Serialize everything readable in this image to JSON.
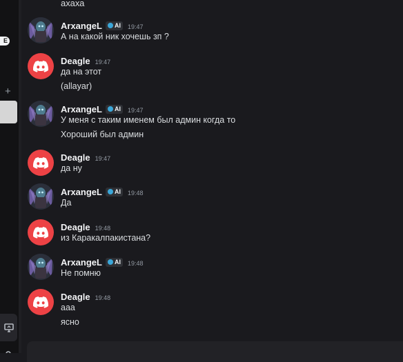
{
  "sidebar": {
    "pill_text": "E",
    "plus_glyph": "+"
  },
  "stub_text": "ахаха",
  "messages": [
    {
      "author": "ArxangeL",
      "avatar": "arxangel-avatar",
      "tag": "AI",
      "time": "19:47",
      "lines": [
        "А на какой ник хочешь зп ?"
      ]
    },
    {
      "author": "Deagle",
      "avatar": "discord-logo-avatar",
      "time": "19:47",
      "lines": [
        "да на этот",
        "(allayar)"
      ]
    },
    {
      "author": "ArxangeL",
      "avatar": "arxangel-avatar",
      "tag": "AI",
      "time": "19:47",
      "lines": [
        "У меня с таким именем был админ когда то",
        "Хороший был админ"
      ]
    },
    {
      "author": "Deagle",
      "avatar": "discord-logo-avatar",
      "time": "19:47",
      "lines": [
        "да ну"
      ]
    },
    {
      "author": "ArxangeL",
      "avatar": "arxangel-avatar",
      "tag": "AI",
      "time": "19:48",
      "lines": [
        "Да"
      ]
    },
    {
      "author": "Deagle",
      "avatar": "discord-logo-avatar",
      "time": "19:48",
      "lines": [
        "из Каракалпакистана?"
      ]
    },
    {
      "author": "ArxangeL",
      "avatar": "arxangel-avatar",
      "tag": "AI",
      "time": "19:48",
      "lines": [
        "Не помню"
      ]
    },
    {
      "author": "Deagle",
      "avatar": "discord-logo-avatar",
      "time": "19:48",
      "lines": [
        "aaa",
        "ясно"
      ]
    }
  ],
  "colors": {
    "discord_red": "#ed4245",
    "background": "#1a1a1e",
    "tag_dot": "#3ba7d9"
  }
}
